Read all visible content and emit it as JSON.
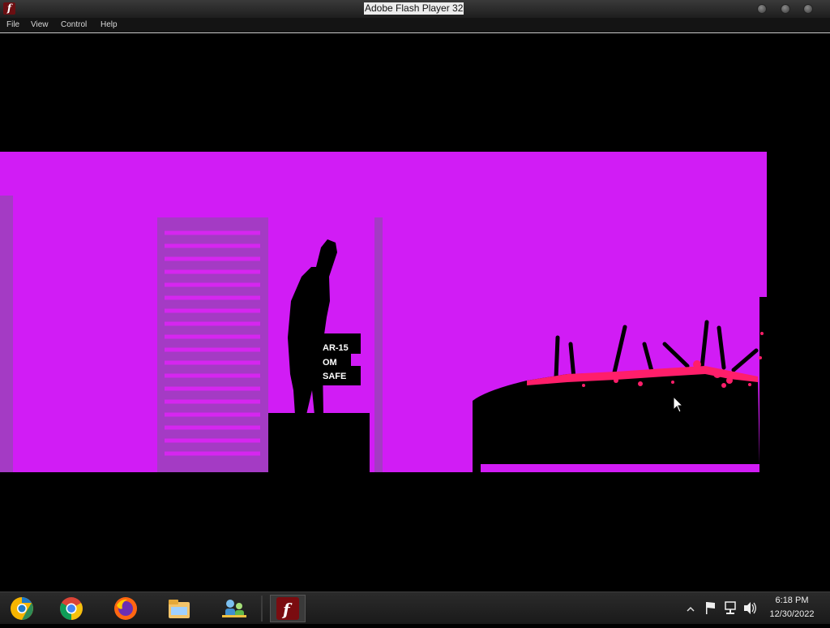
{
  "window": {
    "title": "Adobe Flash Player 32"
  },
  "menu": {
    "file": "File",
    "view": "View",
    "control": "Control",
    "help": "Help"
  },
  "game": {
    "sign_line1": "AR-15",
    "sign_line2": "OM",
    "sign_line3": "SAFE",
    "colors": {
      "background": "#d11cf5",
      "building": "#a43bc4",
      "silhouette": "#000000",
      "blood": "#ff1e6a"
    }
  },
  "taskbar": {
    "apps": [
      "chrome-canary-icon",
      "chrome-icon",
      "firefox-icon",
      "file-explorer-icon",
      "network-users-icon",
      "flash-player-icon"
    ],
    "clock_time": "6:18 PM",
    "clock_date": "12/30/2022"
  }
}
